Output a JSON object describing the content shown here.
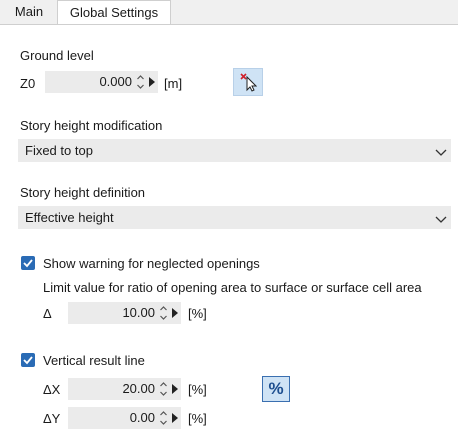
{
  "tabs": [
    {
      "label": "Main"
    },
    {
      "label": "Global Settings"
    }
  ],
  "ground_level": {
    "title": "Ground level",
    "symbol": "Z0",
    "value": "0.000",
    "unit": "[m]"
  },
  "story_height_modification": {
    "title": "Story height modification",
    "selected": "Fixed to top"
  },
  "story_height_definition": {
    "title": "Story height definition",
    "selected": "Effective height"
  },
  "neglected_openings": {
    "label": "Show warning for neglected openings",
    "checked": true,
    "limit_text": "Limit value for ratio of opening area to surface or surface cell area",
    "symbol": "Δ",
    "value": "10.00",
    "unit": "[%]"
  },
  "vertical_result_line": {
    "label": "Vertical result line",
    "checked": true,
    "dx_symbol": "ΔX",
    "dx_value": "20.00",
    "dx_unit": "[%]",
    "dy_symbol": "ΔY",
    "dy_value": "0.00",
    "dy_unit": "[%]",
    "percent_button": "%"
  },
  "colors": {
    "checkbox": "#2a6bb5",
    "button_bg": "#cfe3f5",
    "field_bg": "#ebebeb"
  }
}
